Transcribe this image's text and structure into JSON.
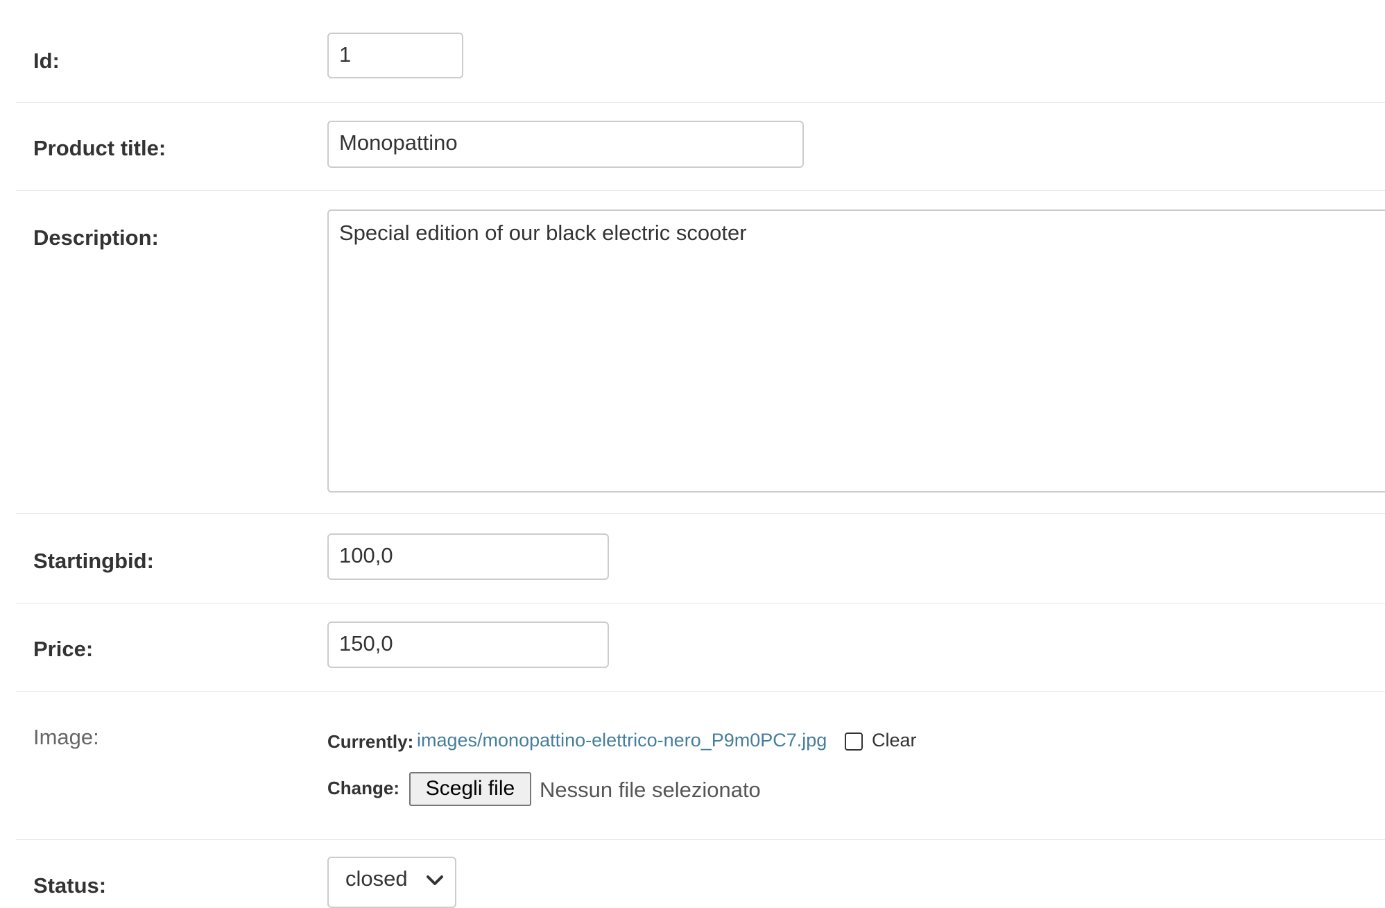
{
  "fields": {
    "id": {
      "label": "Id:",
      "value": "1"
    },
    "product_title": {
      "label": "Product title:",
      "value": "Monopattino"
    },
    "description": {
      "label": "Description:",
      "value": "Special edition of our black electric scooter"
    },
    "startingbid": {
      "label": "Startingbid:",
      "value": "100,0"
    },
    "price": {
      "label": "Price:",
      "value": "150,0"
    },
    "image": {
      "label": "Image:",
      "currently_label": "Currently:",
      "current_file": "images/monopattino-elettrico-nero_P9m0PC7.jpg",
      "clear_label": "Clear",
      "clear_checked": false,
      "change_label": "Change:",
      "choose_button": "Scegli file",
      "no_file_text": "Nessun file selezionato"
    },
    "status": {
      "label": "Status:",
      "value": "closed"
    }
  },
  "colors": {
    "link": "#447e9b",
    "border": "#cccccc",
    "row_divider": "#e6e6e6",
    "label_text": "#333333",
    "optional_label_text": "#666666"
  },
  "icons": {
    "select_arrow": "chevron-down-icon"
  }
}
